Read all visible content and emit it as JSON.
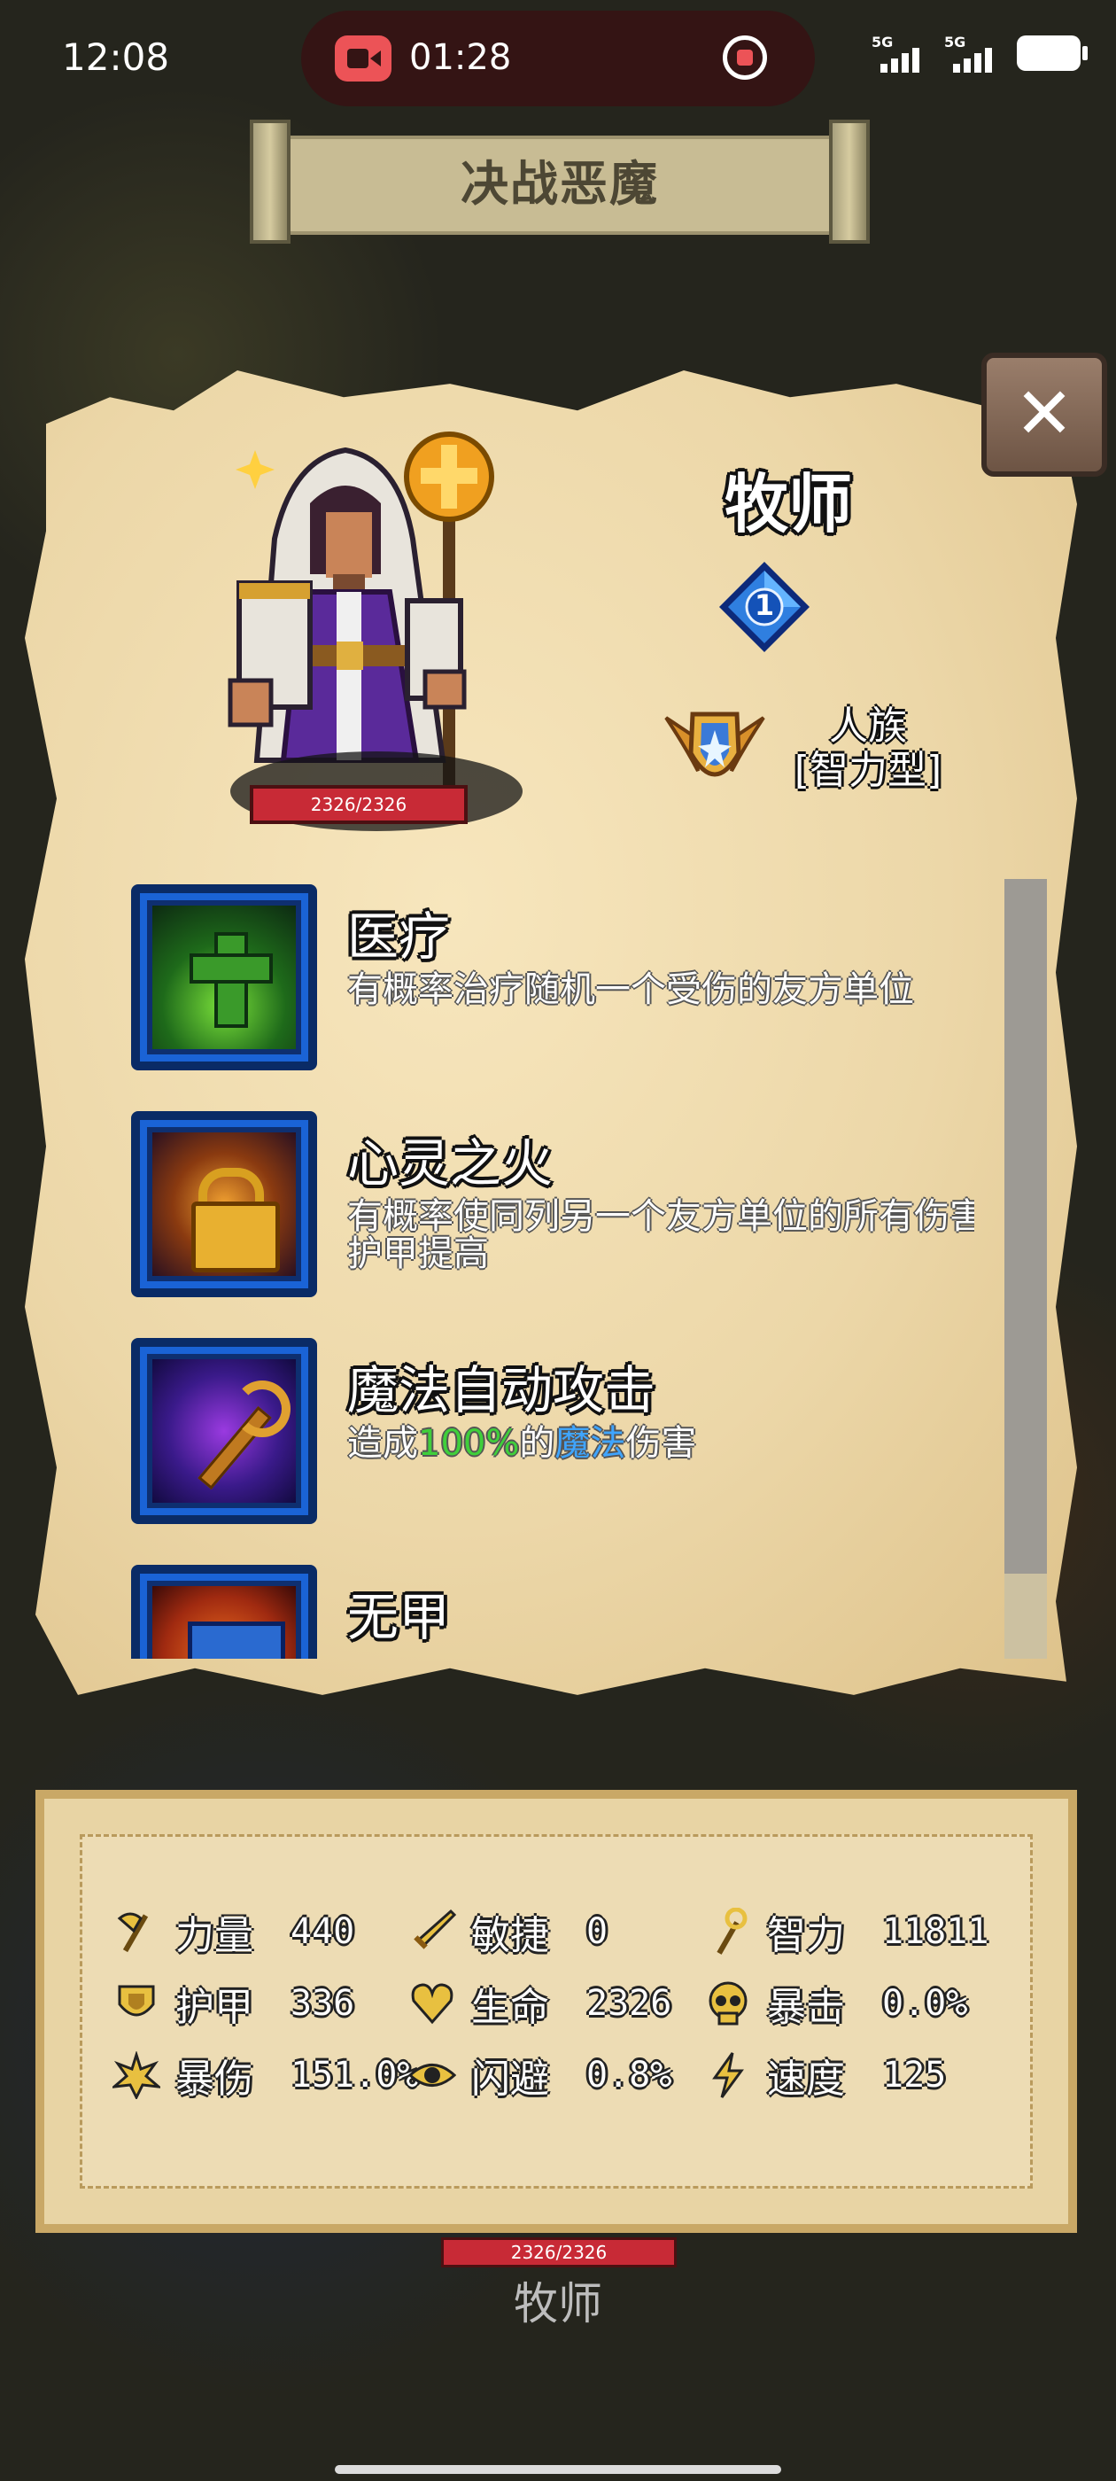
{
  "status_bar": {
    "time": "12:08",
    "recording_time": "01:28",
    "signal1": "5G",
    "signal2": "5G"
  },
  "title": "决战恶魔",
  "close_label": "✕",
  "hero": {
    "name": "牧师",
    "level": "1",
    "hp": "2326/2326",
    "race": "人族",
    "type": "[智力型]"
  },
  "skills": [
    {
      "name": "医疗",
      "desc": "有概率治疗随机一个受伤的友方单位",
      "icon": "healing-cross-icon"
    },
    {
      "name": "心灵之火",
      "desc": "有概率使同列另一个友方单位的所有伤害提高，护甲提高",
      "icon": "inner-fire-lock-icon"
    },
    {
      "name": "魔法自动攻击",
      "desc_prefix": "造成",
      "desc_percent": "100%",
      "desc_mid": "的",
      "desc_magic": "魔法",
      "desc_suffix": "伤害",
      "icon": "magic-staff-icon"
    },
    {
      "name": "无甲",
      "desc": "",
      "icon": "cloth-armor-icon"
    }
  ],
  "stats": {
    "strength": {
      "label": "力量",
      "value": "440",
      "icon": "axe-icon"
    },
    "agility": {
      "label": "敏捷",
      "value": "0",
      "icon": "sword-icon"
    },
    "intelligence": {
      "label": "智力",
      "value": "11811",
      "icon": "staff-icon"
    },
    "armor": {
      "label": "护甲",
      "value": "336",
      "icon": "shield-icon"
    },
    "life": {
      "label": "生命",
      "value": "2326",
      "icon": "heart-icon"
    },
    "crit": {
      "label": "暴击",
      "value": "0.0%",
      "icon": "skull-icon"
    },
    "crit_damage": {
      "label": "暴伤",
      "value": "151.0%",
      "icon": "explosion-icon"
    },
    "dodge": {
      "label": "闪避",
      "value": "0.8%",
      "icon": "eye-icon"
    },
    "speed": {
      "label": "速度",
      "value": "125",
      "icon": "lightning-icon"
    }
  },
  "bottom": {
    "hp": "2326/2326",
    "name": "牧师"
  },
  "colors": {
    "parchment": "#ecd7a8",
    "skill_frame": "#1a63d6",
    "hp_bar": "#c82a36",
    "highlight_green": "#3fcf3a",
    "highlight_blue": "#3fa5ff"
  }
}
